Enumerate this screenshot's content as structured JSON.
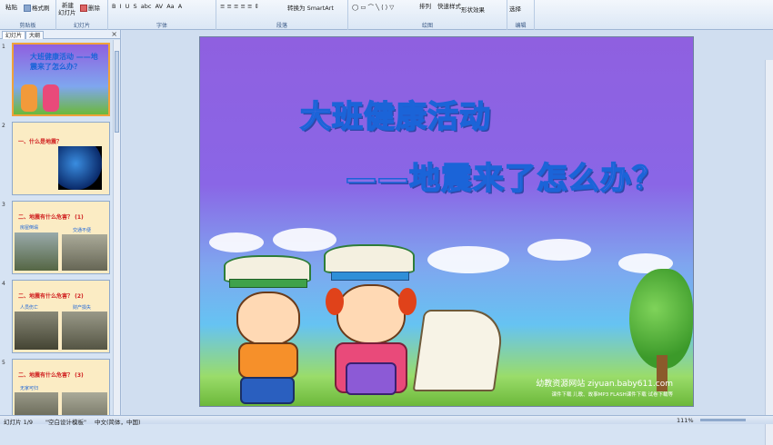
{
  "ribbon": {
    "clipboard": {
      "paste": "粘贴",
      "format_painter": "格式刷",
      "label": "剪贴板"
    },
    "slides": {
      "new_slide": "新建",
      "new_slide2": "幻灯片",
      "delete": "删除",
      "label": "幻灯片"
    },
    "font": {
      "label": "字体"
    },
    "paragraph": {
      "smartart": "转换为 SmartArt",
      "label": "段落"
    },
    "drawing": {
      "arrange": "排列",
      "quick_styles": "快速样式",
      "shape_effects": "形状效果",
      "label": "绘图"
    },
    "editing": {
      "select": "选择",
      "label": "编辑"
    }
  },
  "sidebar": {
    "tabs": [
      "幻灯片",
      "大纲"
    ],
    "close": "×",
    "slide_numbers": [
      "1",
      "2",
      "3",
      "4",
      "5"
    ],
    "thumb_texts": [
      "大班健康活动 ——地震来了怎么办？",
      "一、什么是地震？",
      "二、地震有什么危害？ (1)",
      "二、地震有什么危害？ (2)",
      "二、地震有什么危害？ (3)"
    ],
    "thumb_captions": {
      "t3a": "房屋倒塌",
      "t3b": "交通不便",
      "t4a": "人员伤亡",
      "t4b": "财产损失",
      "t5a": "无家可归"
    }
  },
  "slide": {
    "title_line1": "大班健康活动",
    "title_line2": "——地震来了怎么办？",
    "site_text": "幼教资源网站 ziyuan.baby611.com",
    "site_sub": "课件下载  儿歌、故事MP3  FLASH课件下载  试卷下载等"
  },
  "status": {
    "slide_pos": "幻灯片 1/9",
    "theme": "\"空白设计模板\"",
    "language": "中文(简体，中国)",
    "zoom": "111%"
  },
  "colors": {
    "title_fill": "#8b6ee6",
    "title_stroke": "#1b64d8",
    "accent": "#f0a23a"
  }
}
